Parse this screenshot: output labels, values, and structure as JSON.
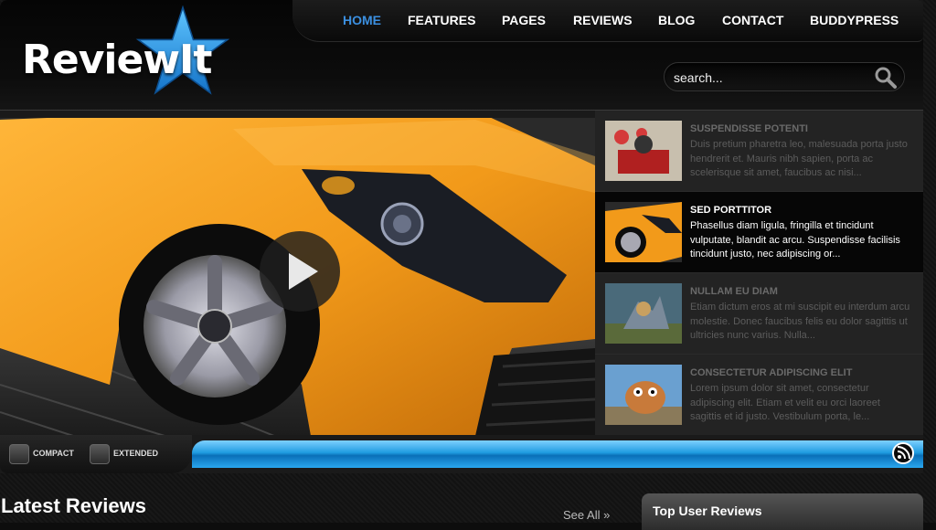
{
  "brand": {
    "logo_text": "ReviewIt"
  },
  "nav": {
    "items": [
      {
        "label": "HOME",
        "active": true
      },
      {
        "label": "FEATURES",
        "active": false
      },
      {
        "label": "PAGES",
        "active": false
      },
      {
        "label": "REVIEWS",
        "active": false
      },
      {
        "label": "BLOG",
        "active": false
      },
      {
        "label": "CONTACT",
        "active": false
      },
      {
        "label": "BUDDYPRESS",
        "active": false
      }
    ]
  },
  "search": {
    "placeholder": "search...",
    "value": ""
  },
  "slider": {
    "items": [
      {
        "title": "SUSPENDISSE POTENTI",
        "desc": "Duis pretium pharetra leo, malesuada porta justo hendrerit et. Mauris nibh sapien, porta ac scelerisque sit amet, faucibus ac nisi...",
        "active": false
      },
      {
        "title": "SED PORTTITOR",
        "desc": "Phasellus diam ligula, fringilla et tincidunt vulputate, blandit ac arcu. Suspendisse facilisis tincidunt justo, nec adipiscing or...",
        "active": true
      },
      {
        "title": "NULLAM EU DIAM",
        "desc": "Etiam dictum eros at mi suscipit eu interdum arcu molestie. Donec faucibus felis eu dolor sagittis ut ultricies nunc varius. Nulla...",
        "active": false
      },
      {
        "title": "CONSECTETUR ADIPISCING ELIT",
        "desc": "Lorem ipsum dolor sit amet, consectetur adipiscing elit. Etiam et velit eu orci laoreet sagittis et id justo. Vestibulum porta, le...",
        "active": false
      }
    ]
  },
  "view_toggle": {
    "compact_label": "COMPACT",
    "extended_label": "EXTENDED"
  },
  "content": {
    "latest_heading": "Latest Reviews",
    "see_all": "See All »",
    "top_user_title": "Top User Reviews"
  },
  "colors": {
    "accent_blue": "#3b8fe0",
    "bar_blue": "#1e9be0",
    "car_orange": "#f29a1a"
  }
}
